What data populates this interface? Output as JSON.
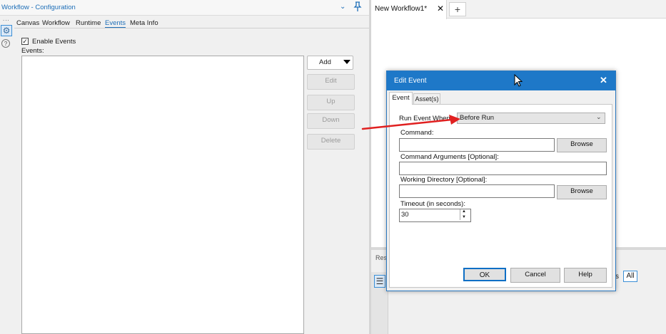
{
  "config_panel": {
    "title": "Workflow - Configuration",
    "dots": "...",
    "tabs": [
      "Canvas",
      "Workflow",
      "Runtime",
      "Events",
      "Meta Info"
    ],
    "active_tab": "Events",
    "enable_events_label": "Enable Events",
    "enable_events_checked": true,
    "events_label": "Events:",
    "buttons": {
      "add": "Add",
      "edit": "Edit",
      "up": "Up",
      "down": "Down",
      "delete": "Delete"
    }
  },
  "document": {
    "tab_label": "New Workflow1*",
    "close_glyph": "✕",
    "new_tab_glyph": "+"
  },
  "results": {
    "tab_label": "Res",
    "s_text": "s",
    "all_button": "All"
  },
  "dialog": {
    "title": "Edit Event",
    "close_glyph": "✕",
    "tabs": [
      "Event",
      "Asset(s)"
    ],
    "run_event_when_label": "Run Event When:",
    "run_event_when_value": "Before Run",
    "command_label": "Command:",
    "command_value": "",
    "browse_label": "Browse",
    "command_args_label": "Command Arguments [Optional]:",
    "command_args_value": "",
    "working_dir_label": "Working Directory [Optional]:",
    "working_dir_value": "",
    "timeout_label": "Timeout (in seconds):",
    "timeout_value": "30",
    "ok_label": "OK",
    "cancel_label": "Cancel",
    "help_label": "Help"
  },
  "colors": {
    "accent": "#1f6fb8",
    "dialog_title_bar": "#1e78c8",
    "annotation_arrow": "#e02020"
  },
  "icons": [
    "pin-icon",
    "chevron-down-icon",
    "gear-icon",
    "help-icon",
    "close-icon",
    "plus-icon",
    "cursor-icon",
    "list-icon"
  ]
}
